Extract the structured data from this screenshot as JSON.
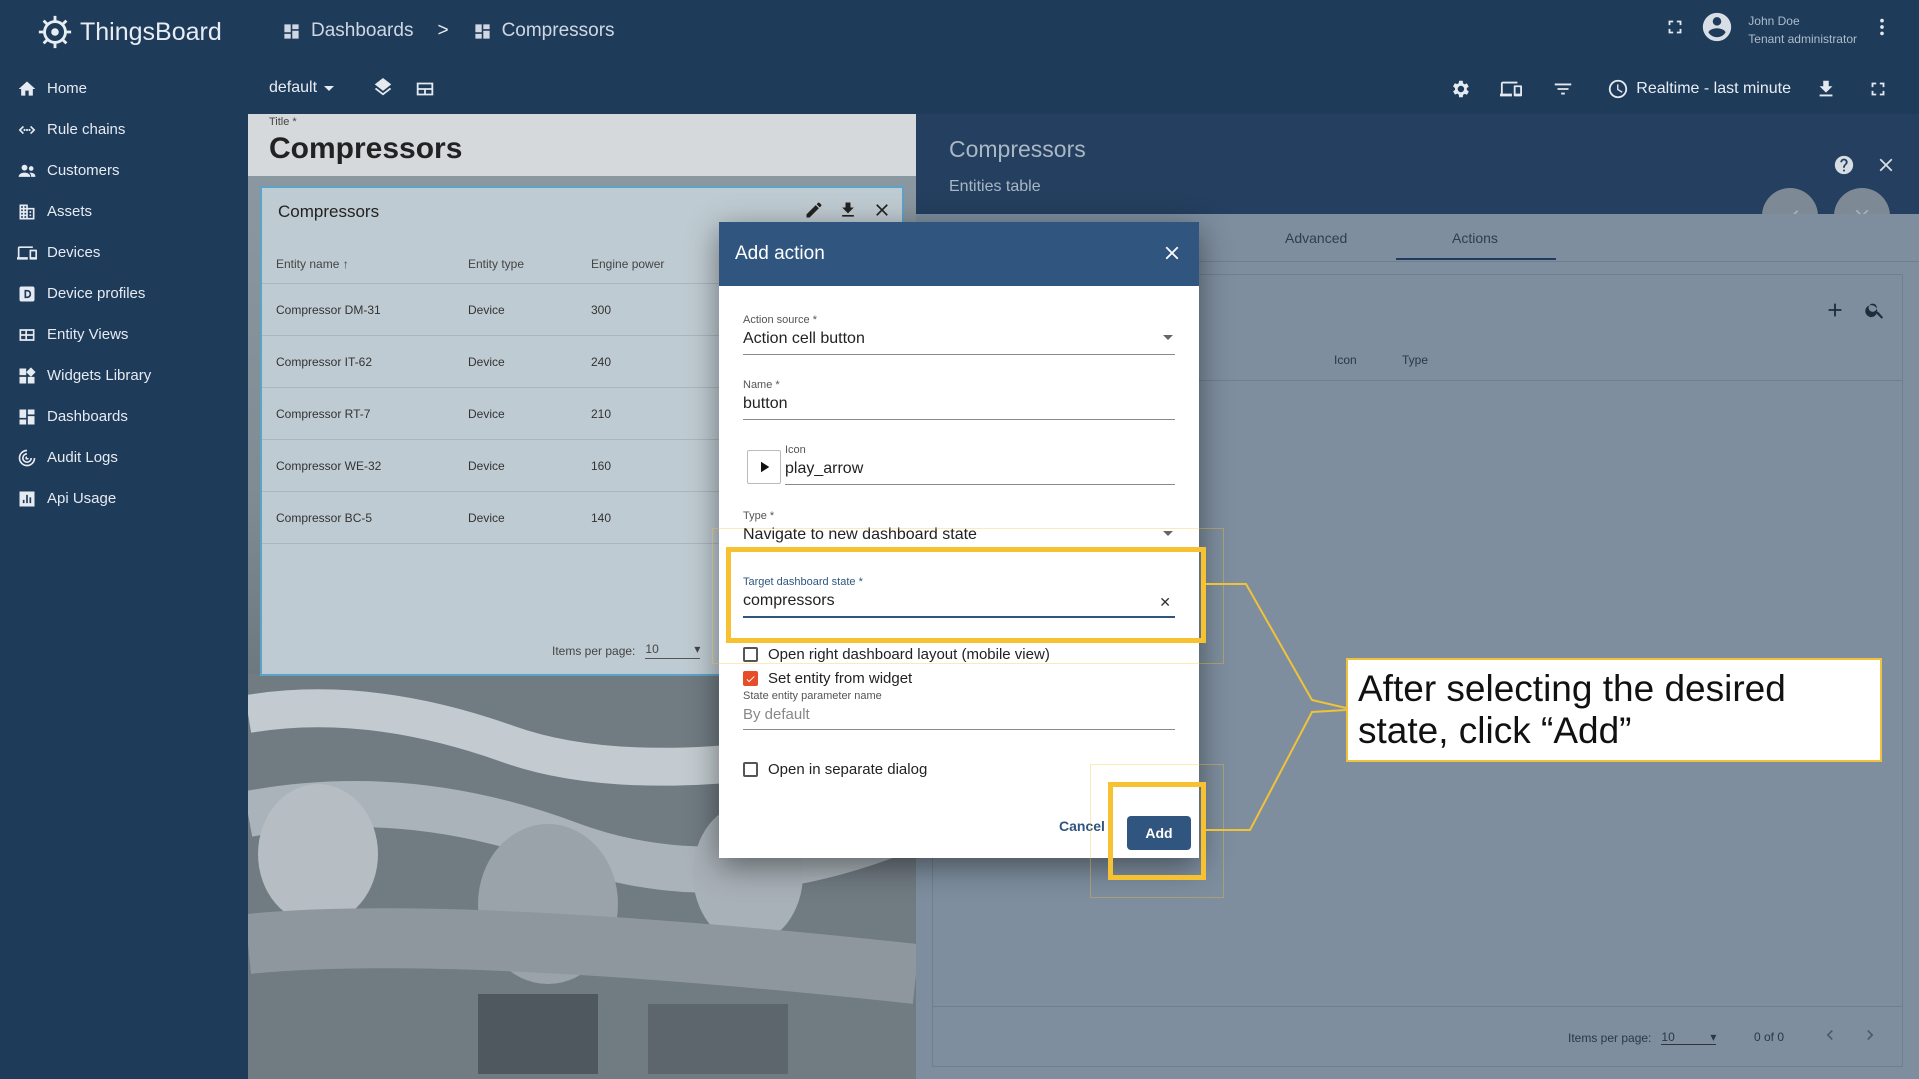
{
  "app": {
    "name": "ThingsBoard"
  },
  "sidebar": {
    "items": [
      {
        "label": "Home",
        "icon": "home-icon"
      },
      {
        "label": "Rule chains",
        "icon": "rule-chains-icon"
      },
      {
        "label": "Customers",
        "icon": "customers-icon"
      },
      {
        "label": "Assets",
        "icon": "assets-icon"
      },
      {
        "label": "Devices",
        "icon": "devices-icon"
      },
      {
        "label": "Device profiles",
        "icon": "device-profiles-icon"
      },
      {
        "label": "Entity Views",
        "icon": "entity-views-icon"
      },
      {
        "label": "Widgets Library",
        "icon": "widgets-library-icon"
      },
      {
        "label": "Dashboards",
        "icon": "dashboards-icon"
      },
      {
        "label": "Audit Logs",
        "icon": "audit-logs-icon"
      },
      {
        "label": "Api Usage",
        "icon": "api-usage-icon"
      }
    ]
  },
  "header": {
    "breadcrumb_1": "Dashboards",
    "separator": ">",
    "breadcrumb_2": "Compressors",
    "user_name": "John Doe",
    "user_role": "Tenant administrator"
  },
  "toolbar": {
    "state": "default",
    "timewindow": "Realtime - last minute"
  },
  "dashboard": {
    "title_label": "Title *",
    "title": "Compressors",
    "widget": {
      "title": "Compressors",
      "columns": [
        "Entity name",
        "Entity type",
        "Engine power"
      ],
      "rows": [
        [
          "Compressor DM-31",
          "Device",
          "300"
        ],
        [
          "Compressor IT-62",
          "Device",
          "240"
        ],
        [
          "Compressor RT-7",
          "Device",
          "210"
        ],
        [
          "Compressor WE-32",
          "Device",
          "160"
        ],
        [
          "Compressor BC-5",
          "Device",
          "140"
        ]
      ],
      "items_per_page_label": "Items per page:",
      "items_per_page": "10"
    }
  },
  "right_panel": {
    "title": "Compressors",
    "subtitle": "Entities table",
    "tabs": [
      "Advanced",
      "Actions"
    ],
    "columns": [
      "Icon",
      "Type"
    ],
    "items_per_page_label": "Items per page:",
    "items_per_page": "10",
    "count": "0 of 0"
  },
  "dialog": {
    "title": "Add action",
    "action_source_label": "Action source *",
    "action_source": "Action cell button",
    "name_label": "Name *",
    "name": "button",
    "icon_label": "Icon",
    "icon": "play_arrow",
    "type_label": "Type *",
    "type": "Navigate to new dashboard state",
    "target_label": "Target dashboard state *",
    "target": "compressors",
    "open_right_layout": "Open right dashboard layout (mobile view)",
    "set_entity": "Set entity from widget",
    "state_param_label": "State entity parameter name",
    "state_param_placeholder": "By default",
    "open_separate": "Open in separate dialog",
    "cancel": "Cancel",
    "add": "Add"
  },
  "annotation": {
    "text": "After selecting the desired state, click “Add”",
    "color": "#f6c232"
  }
}
